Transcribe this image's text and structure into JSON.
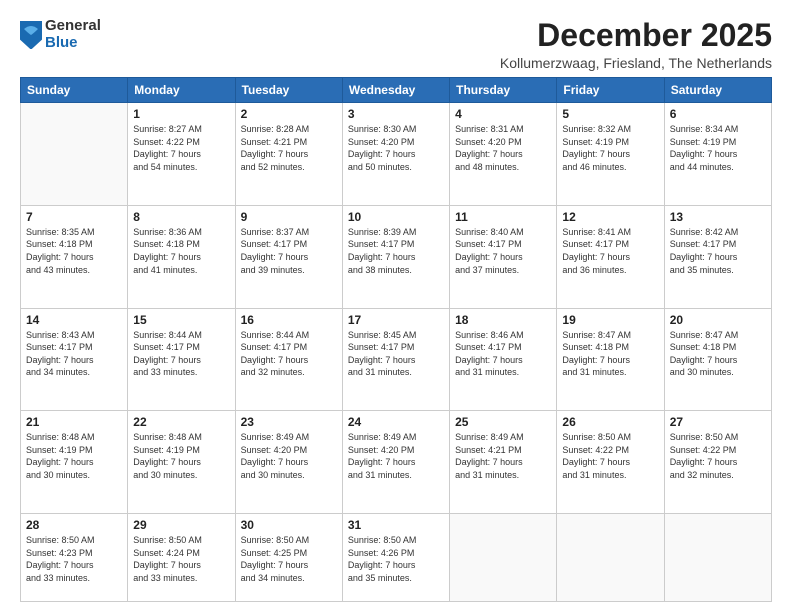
{
  "logo": {
    "general": "General",
    "blue": "Blue"
  },
  "header": {
    "month": "December 2025",
    "location": "Kollumerzwaag, Friesland, The Netherlands"
  },
  "weekdays": [
    "Sunday",
    "Monday",
    "Tuesday",
    "Wednesday",
    "Thursday",
    "Friday",
    "Saturday"
  ],
  "weeks": [
    [
      {
        "day": "",
        "info": ""
      },
      {
        "day": "1",
        "info": "Sunrise: 8:27 AM\nSunset: 4:22 PM\nDaylight: 7 hours\nand 54 minutes."
      },
      {
        "day": "2",
        "info": "Sunrise: 8:28 AM\nSunset: 4:21 PM\nDaylight: 7 hours\nand 52 minutes."
      },
      {
        "day": "3",
        "info": "Sunrise: 8:30 AM\nSunset: 4:20 PM\nDaylight: 7 hours\nand 50 minutes."
      },
      {
        "day": "4",
        "info": "Sunrise: 8:31 AM\nSunset: 4:20 PM\nDaylight: 7 hours\nand 48 minutes."
      },
      {
        "day": "5",
        "info": "Sunrise: 8:32 AM\nSunset: 4:19 PM\nDaylight: 7 hours\nand 46 minutes."
      },
      {
        "day": "6",
        "info": "Sunrise: 8:34 AM\nSunset: 4:19 PM\nDaylight: 7 hours\nand 44 minutes."
      }
    ],
    [
      {
        "day": "7",
        "info": "Sunrise: 8:35 AM\nSunset: 4:18 PM\nDaylight: 7 hours\nand 43 minutes."
      },
      {
        "day": "8",
        "info": "Sunrise: 8:36 AM\nSunset: 4:18 PM\nDaylight: 7 hours\nand 41 minutes."
      },
      {
        "day": "9",
        "info": "Sunrise: 8:37 AM\nSunset: 4:17 PM\nDaylight: 7 hours\nand 39 minutes."
      },
      {
        "day": "10",
        "info": "Sunrise: 8:39 AM\nSunset: 4:17 PM\nDaylight: 7 hours\nand 38 minutes."
      },
      {
        "day": "11",
        "info": "Sunrise: 8:40 AM\nSunset: 4:17 PM\nDaylight: 7 hours\nand 37 minutes."
      },
      {
        "day": "12",
        "info": "Sunrise: 8:41 AM\nSunset: 4:17 PM\nDaylight: 7 hours\nand 36 minutes."
      },
      {
        "day": "13",
        "info": "Sunrise: 8:42 AM\nSunset: 4:17 PM\nDaylight: 7 hours\nand 35 minutes."
      }
    ],
    [
      {
        "day": "14",
        "info": "Sunrise: 8:43 AM\nSunset: 4:17 PM\nDaylight: 7 hours\nand 34 minutes."
      },
      {
        "day": "15",
        "info": "Sunrise: 8:44 AM\nSunset: 4:17 PM\nDaylight: 7 hours\nand 33 minutes."
      },
      {
        "day": "16",
        "info": "Sunrise: 8:44 AM\nSunset: 4:17 PM\nDaylight: 7 hours\nand 32 minutes."
      },
      {
        "day": "17",
        "info": "Sunrise: 8:45 AM\nSunset: 4:17 PM\nDaylight: 7 hours\nand 31 minutes."
      },
      {
        "day": "18",
        "info": "Sunrise: 8:46 AM\nSunset: 4:17 PM\nDaylight: 7 hours\nand 31 minutes."
      },
      {
        "day": "19",
        "info": "Sunrise: 8:47 AM\nSunset: 4:18 PM\nDaylight: 7 hours\nand 31 minutes."
      },
      {
        "day": "20",
        "info": "Sunrise: 8:47 AM\nSunset: 4:18 PM\nDaylight: 7 hours\nand 30 minutes."
      }
    ],
    [
      {
        "day": "21",
        "info": "Sunrise: 8:48 AM\nSunset: 4:19 PM\nDaylight: 7 hours\nand 30 minutes."
      },
      {
        "day": "22",
        "info": "Sunrise: 8:48 AM\nSunset: 4:19 PM\nDaylight: 7 hours\nand 30 minutes."
      },
      {
        "day": "23",
        "info": "Sunrise: 8:49 AM\nSunset: 4:20 PM\nDaylight: 7 hours\nand 30 minutes."
      },
      {
        "day": "24",
        "info": "Sunrise: 8:49 AM\nSunset: 4:20 PM\nDaylight: 7 hours\nand 31 minutes."
      },
      {
        "day": "25",
        "info": "Sunrise: 8:49 AM\nSunset: 4:21 PM\nDaylight: 7 hours\nand 31 minutes."
      },
      {
        "day": "26",
        "info": "Sunrise: 8:50 AM\nSunset: 4:22 PM\nDaylight: 7 hours\nand 31 minutes."
      },
      {
        "day": "27",
        "info": "Sunrise: 8:50 AM\nSunset: 4:22 PM\nDaylight: 7 hours\nand 32 minutes."
      }
    ],
    [
      {
        "day": "28",
        "info": "Sunrise: 8:50 AM\nSunset: 4:23 PM\nDaylight: 7 hours\nand 33 minutes."
      },
      {
        "day": "29",
        "info": "Sunrise: 8:50 AM\nSunset: 4:24 PM\nDaylight: 7 hours\nand 33 minutes."
      },
      {
        "day": "30",
        "info": "Sunrise: 8:50 AM\nSunset: 4:25 PM\nDaylight: 7 hours\nand 34 minutes."
      },
      {
        "day": "31",
        "info": "Sunrise: 8:50 AM\nSunset: 4:26 PM\nDaylight: 7 hours\nand 35 minutes."
      },
      {
        "day": "",
        "info": ""
      },
      {
        "day": "",
        "info": ""
      },
      {
        "day": "",
        "info": ""
      }
    ]
  ]
}
